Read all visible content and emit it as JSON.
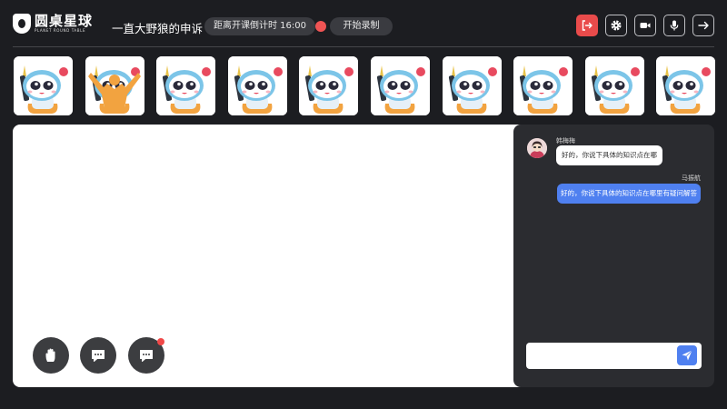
{
  "brand": {
    "name": "圆桌星球",
    "subtitle": "PLANET ROUND TABLE"
  },
  "header": {
    "title": "一直大野狼的申诉",
    "countdown": "距离开课倒计时 16:00",
    "record_label": "开始录制",
    "buttons": [
      "exit-icon",
      "gear-icon",
      "camera-icon",
      "microphone-icon",
      "arrow-right-icon"
    ]
  },
  "participants": [
    {
      "avatar": "astronaut-mascot",
      "hand_raised": false
    },
    {
      "avatar": "astronaut-mascot",
      "hand_raised": true
    },
    {
      "avatar": "astronaut-mascot",
      "hand_raised": false
    },
    {
      "avatar": "astronaut-mascot",
      "hand_raised": false
    },
    {
      "avatar": "astronaut-mascot",
      "hand_raised": false
    },
    {
      "avatar": "astronaut-mascot",
      "hand_raised": false
    },
    {
      "avatar": "astronaut-mascot",
      "hand_raised": false
    },
    {
      "avatar": "astronaut-mascot",
      "hand_raised": false
    },
    {
      "avatar": "astronaut-mascot",
      "hand_raised": false
    },
    {
      "avatar": "astronaut-mascot",
      "hand_raised": false
    }
  ],
  "board_actions": [
    "raise-hand-icon",
    "chat-bubble-icon",
    "chat-notification-icon"
  ],
  "chat": {
    "messages": [
      {
        "sender": "韩梅梅",
        "text": "好的，你说下具体的知识点在哪",
        "side": "left"
      },
      {
        "sender": "马振航",
        "text": "好的，你说下具体的知识点在哪里有疑问解答",
        "side": "right"
      }
    ],
    "input_placeholder": "",
    "send_icon": "send-icon"
  },
  "colors": {
    "background": "#1c1d21",
    "panel": "#2b2c30",
    "accent_blue": "#4f80f0",
    "record_red": "#f05454",
    "exit_red": "#e94b4b"
  }
}
